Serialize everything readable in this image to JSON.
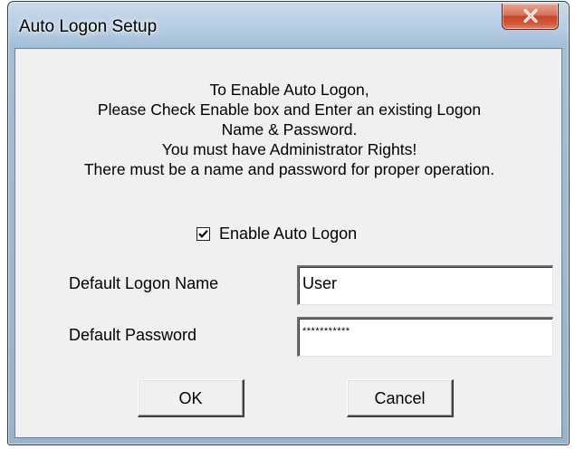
{
  "window": {
    "title": "Auto Logon Setup",
    "close_icon": "close-x-icon"
  },
  "message": {
    "lines": [
      "To Enable Auto Logon,",
      "Please Check Enable box and Enter an existing Logon",
      "Name & Password.",
      "You must have Administrator Rights!",
      "There must be a name and password for proper operation."
    ]
  },
  "enable": {
    "label": "Enable Auto Logon",
    "checked": true
  },
  "fields": {
    "name_label": "Default Logon Name",
    "name_value": "User",
    "password_label": "Default Password",
    "password_value": "***********"
  },
  "buttons": {
    "ok_label": "OK",
    "cancel_label": "Cancel"
  },
  "colors": {
    "frame": "#a5bfd8",
    "close_button": "#c8452a",
    "client_bg": "#f0f0f0"
  }
}
